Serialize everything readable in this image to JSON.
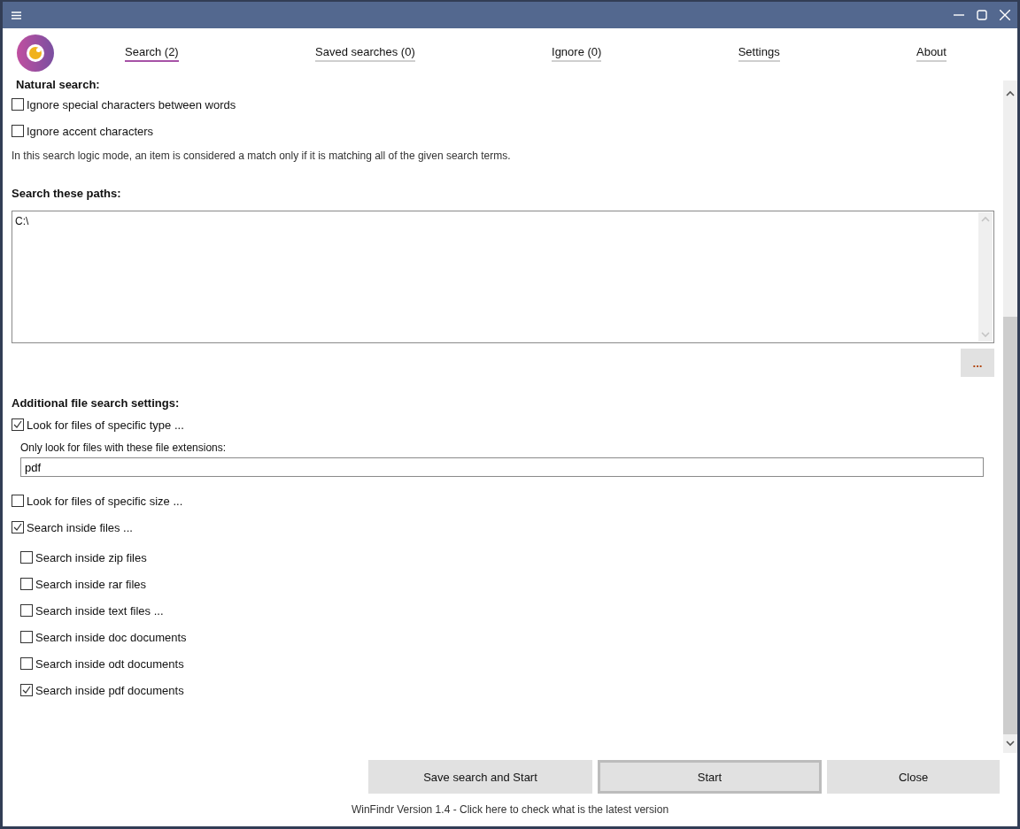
{
  "tabs": [
    {
      "label": "Search (2)",
      "selected": true
    },
    {
      "label": "Saved searches (0)",
      "selected": false
    },
    {
      "label": "Ignore (0)",
      "selected": false
    },
    {
      "label": "Settings",
      "selected": false
    },
    {
      "label": "About",
      "selected": false
    }
  ],
  "natural_search": {
    "heading": "Natural search:",
    "options": [
      {
        "label": "Ignore special characters between words",
        "checked": false
      },
      {
        "label": "Ignore accent characters",
        "checked": false
      }
    ],
    "note": "In this search logic mode, an item is considered a match only if it is matching all of the given search terms."
  },
  "paths": {
    "heading": "Search these paths:",
    "value": "C:\\",
    "browse_button": "..."
  },
  "additional": {
    "heading": "Additional file search settings:",
    "options": [
      {
        "label": "Look for files of specific type ...",
        "checked": true,
        "extension_field": {
          "label": "Only look for files with these file extensions:",
          "value": "pdf"
        }
      },
      {
        "label": "Look for files of specific size ...",
        "checked": false
      },
      {
        "label": "Search inside files ...",
        "checked": true,
        "children": [
          {
            "label": "Search inside zip files",
            "checked": false
          },
          {
            "label": "Search inside rar files",
            "checked": false
          },
          {
            "label": "Search inside text files ...",
            "checked": false
          },
          {
            "label": "Search inside doc documents",
            "checked": false
          },
          {
            "label": "Search inside odt documents",
            "checked": false
          },
          {
            "label": "Search inside pdf documents",
            "checked": true
          }
        ]
      }
    ]
  },
  "buttons": [
    {
      "label": "Save search and Start",
      "selected": false
    },
    {
      "label": "Start",
      "selected": true
    },
    {
      "label": "Close",
      "selected": false
    }
  ],
  "footer": "WinFindr Version 1.4 - Click here to check what is the latest version"
}
